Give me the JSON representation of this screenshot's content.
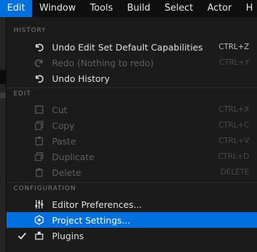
{
  "menubar": {
    "items": [
      "Edit",
      "Window",
      "Tools",
      "Build",
      "Select",
      "Actor",
      "H"
    ]
  },
  "menu": {
    "sections": [
      {
        "header": "HISTORY",
        "items": [
          {
            "label": "Undo Edit Set Default Capabilities",
            "shortcut": "CTRL+Z",
            "icon": "undo-icon",
            "enabled": true
          },
          {
            "label": "Redo (Nothing to redo)",
            "shortcut": "CTRL+Y",
            "icon": "redo-icon",
            "enabled": false
          },
          {
            "label": "Undo History",
            "shortcut": "",
            "icon": "undo-history-icon",
            "enabled": true
          }
        ]
      },
      {
        "header": "EDIT",
        "items": [
          {
            "label": "Cut",
            "shortcut": "CTRL+X",
            "icon": "cut-icon",
            "enabled": false
          },
          {
            "label": "Copy",
            "shortcut": "CTRL+C",
            "icon": "copy-icon",
            "enabled": false
          },
          {
            "label": "Paste",
            "shortcut": "CTRL+V",
            "icon": "paste-icon",
            "enabled": false
          },
          {
            "label": "Duplicate",
            "shortcut": "CTRL+D",
            "icon": "duplicate-icon",
            "enabled": false
          },
          {
            "label": "Delete",
            "shortcut": "DELETE",
            "icon": "delete-icon",
            "enabled": false
          }
        ]
      },
      {
        "header": "CONFIGURATION",
        "items": [
          {
            "label": "Editor Preferences...",
            "shortcut": "",
            "icon": "sliders-icon",
            "enabled": true
          },
          {
            "label": "Project Settings...",
            "shortcut": "",
            "icon": "project-settings-icon",
            "enabled": true,
            "highlighted": true
          },
          {
            "label": "Plugins",
            "shortcut": "",
            "icon": "plugins-icon",
            "enabled": true,
            "checked": true
          }
        ]
      }
    ]
  },
  "colors": {
    "accent": "#0070e0",
    "menu_bg": "#1b1b1b",
    "text": "#e0e0e0",
    "disabled_text": "#5e5e5e"
  }
}
